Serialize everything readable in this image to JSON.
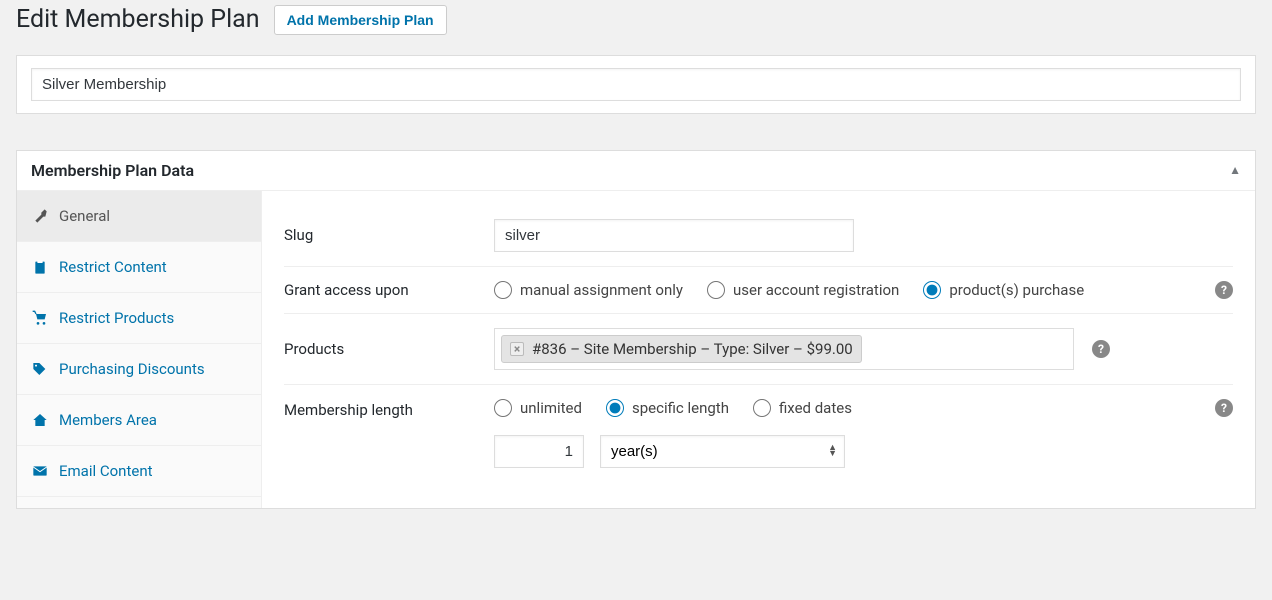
{
  "header": {
    "title": "Edit Membership Plan",
    "add_button": "Add Membership Plan"
  },
  "post": {
    "title": "Silver Membership"
  },
  "panel": {
    "title": "Membership Plan Data"
  },
  "tabs": [
    {
      "id": "general",
      "label": "General",
      "icon": "wrench",
      "active": true
    },
    {
      "id": "restrict-content",
      "label": "Restrict Content",
      "icon": "clipboard",
      "active": false
    },
    {
      "id": "restrict-products",
      "label": "Restrict Products",
      "icon": "cart",
      "active": false
    },
    {
      "id": "purchasing-discounts",
      "label": "Purchasing Discounts",
      "icon": "tag",
      "active": false
    },
    {
      "id": "members-area",
      "label": "Members Area",
      "icon": "home",
      "active": false
    },
    {
      "id": "email-content",
      "label": "Email Content",
      "icon": "mail",
      "active": false
    }
  ],
  "fields": {
    "slug": {
      "label": "Slug",
      "value": "silver"
    },
    "grant_access": {
      "label": "Grant access upon",
      "options": [
        {
          "id": "manual",
          "label": "manual assignment only",
          "selected": false
        },
        {
          "id": "registration",
          "label": "user account registration",
          "selected": false
        },
        {
          "id": "purchase",
          "label": "product(s) purchase",
          "selected": true
        }
      ]
    },
    "products": {
      "label": "Products",
      "chips": [
        {
          "text": "#836 – Site Membership – Type: Silver – $99.00"
        }
      ]
    },
    "length": {
      "label": "Membership length",
      "options": [
        {
          "id": "unlimited",
          "label": "unlimited",
          "selected": false
        },
        {
          "id": "specific",
          "label": "specific length",
          "selected": true
        },
        {
          "id": "fixed",
          "label": "fixed dates",
          "selected": false
        }
      ],
      "number": "1",
      "unit": "year(s)"
    }
  }
}
